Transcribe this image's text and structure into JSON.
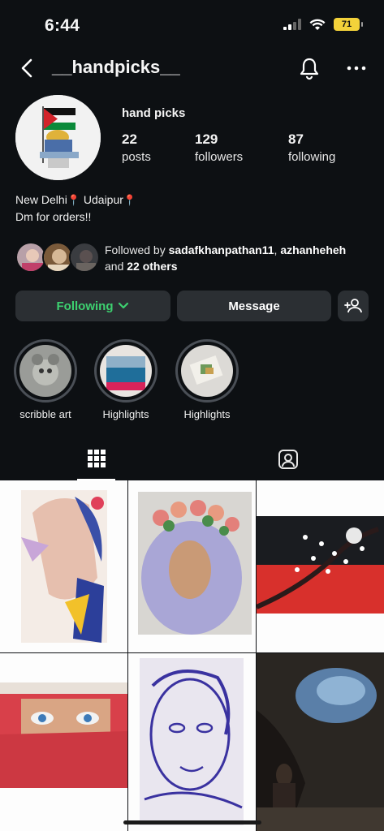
{
  "status_bar": {
    "time": "6:44",
    "battery": "71"
  },
  "header": {
    "username": "__handpicks__",
    "icons": [
      "chevron-left-icon",
      "bell-icon",
      "more-icon"
    ]
  },
  "profile": {
    "display_name": "hand picks",
    "stats": [
      {
        "value": "22",
        "label": "posts"
      },
      {
        "value": "129",
        "label": "followers"
      },
      {
        "value": "87",
        "label": "following"
      }
    ],
    "bio_line1_a": "New Delhi",
    "bio_line1_b": "Udaipur",
    "bio_line2": "Dm for orders!!",
    "followed_prefix": "Followed by ",
    "followed_user1": "sadafkhanpathan11",
    "followed_sep": ", ",
    "followed_user2": "azhanheheh",
    "followed_and": "and ",
    "followed_others": "22 others"
  },
  "buttons": {
    "following": "Following",
    "message": "Message"
  },
  "highlights": [
    {
      "label": "scribble art"
    },
    {
      "label": "Highlights"
    },
    {
      "label": "Highlights"
    }
  ],
  "tabs": [
    "grid-icon",
    "tagged-icon"
  ],
  "colors": {
    "background": "#0d1013",
    "button": "#2b2f33",
    "following_green": "#3dd170",
    "battery": "#f3d23a"
  }
}
